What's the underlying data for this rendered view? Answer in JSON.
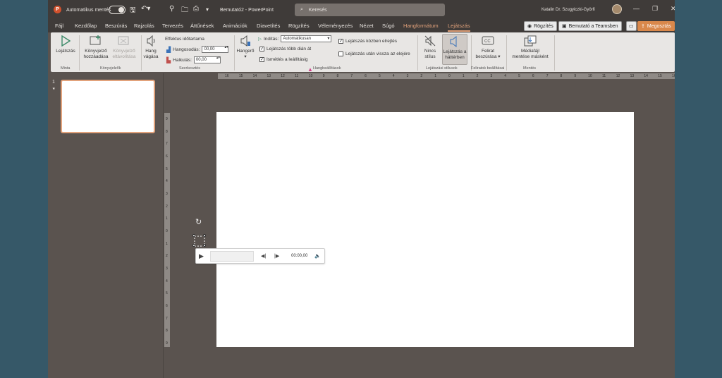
{
  "titlebar": {
    "autosave_label": "Automatikus mentés",
    "doc_title": "Bemutató2",
    "sep": " - ",
    "app_name": "PowerPoint",
    "search_placeholder": "Keresés",
    "user_name": "Katalin Dr. Szugyiczki-Györfi"
  },
  "menu": {
    "tabs": [
      "Fájl",
      "Kezdőlap",
      "Beszúrás",
      "Rajzolás",
      "Tervezés",
      "Áttűnések",
      "Animációk",
      "Diavetítés",
      "Rögzítés",
      "Véleményezés",
      "Nézet",
      "Súgó",
      "Hangformátum",
      "Lejátszás"
    ],
    "record_label": "Rögzítés",
    "teams_label": "Bemutató a Teamsben",
    "share_label": "Megosztás"
  },
  "ribbon": {
    "groups": {
      "minta": "Minta",
      "konyvjelzok": "Könyvjelzők",
      "szerkesztes": "Szerkesztés",
      "hangbeallitasok": "Hangbeállítások",
      "lejatszasi_stilusok": "Lejátszási stílusok",
      "feliratok": "Feliratok beállításai",
      "mentes": "Mentés"
    },
    "play": "Lejátszás",
    "add_bookmark_1": "Könyvjelző",
    "add_bookmark_2": "hozzáadása",
    "remove_bookmark_1": "Könyvjelző",
    "remove_bookmark_2": "eltávolítása",
    "trim_1": "Hang",
    "trim_2": "vágása",
    "fade_duration": "Effektus időtartama",
    "fade_in_label": "Hangosodás:",
    "fade_in_value": "00,00",
    "fade_out_label": "Halkulás:",
    "fade_out_value": "00,00",
    "volume": "Hangerő",
    "start_label": "Indítás:",
    "start_value": "Automatikusan",
    "across_slides": "Lejátszás több dián át",
    "loop": "Ismétlés a leállításig",
    "hide_during": "Lejátszás közben elrejtés",
    "rewind": "Lejátszás után vissza az elejére",
    "no_style_1": "Nincs",
    "no_style_2": "stílus",
    "bg_play_1": "Lejátszás a",
    "bg_play_2": "háttérben",
    "caption_1": "Felirat",
    "caption_2": "beszúrása",
    "save_media_1": "Médiafájl",
    "save_media_2": "mentése másként"
  },
  "slides_pane": {
    "slide_number": "1"
  },
  "ruler": {
    "h_ticks": [
      "16",
      "15",
      "14",
      "13",
      "12",
      "11",
      "10",
      "9",
      "8",
      "7",
      "6",
      "5",
      "4",
      "3",
      "2",
      "1",
      "0",
      "1",
      "2",
      "3",
      "4",
      "5",
      "6",
      "7",
      "8",
      "9",
      "10",
      "11",
      "12",
      "13",
      "14",
      "15",
      "16"
    ],
    "v_ticks": [
      "9",
      "8",
      "7",
      "6",
      "5",
      "4",
      "3",
      "2",
      "1",
      "0",
      "1",
      "2",
      "3",
      "4",
      "5",
      "6",
      "7",
      "8",
      "9"
    ]
  },
  "player": {
    "time": "00:00,00"
  },
  "colors": {
    "accent": "#e2a27b",
    "app_bg": "#5a534f",
    "ribbon": "#e8e6e4",
    "outer_bg": "#365868"
  }
}
